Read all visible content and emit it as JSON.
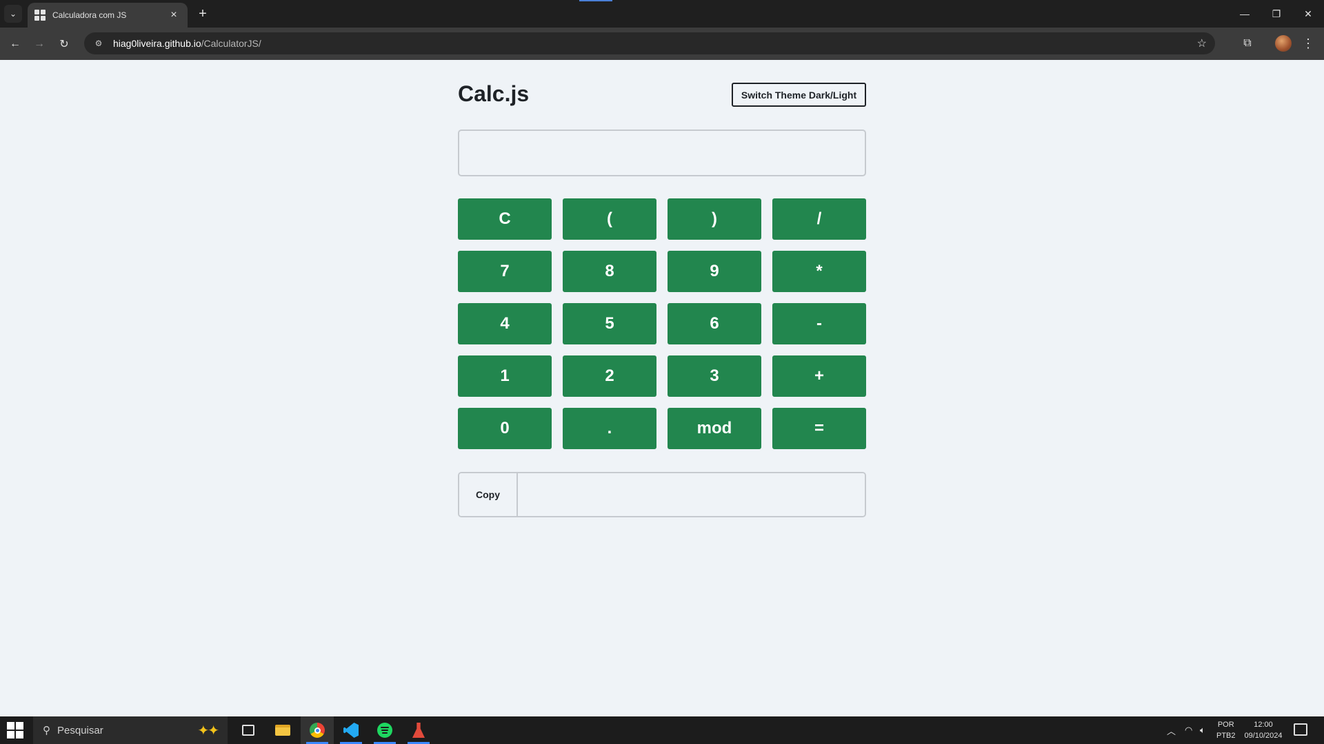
{
  "browser": {
    "tab_title": "Calculadora com JS",
    "tab_close": "×",
    "new_tab": "+",
    "tab_list": "⌄",
    "url_host": "hiag0liveira.github.io",
    "url_path": "/CalculatorJS/",
    "back": "←",
    "forward": "→",
    "reload": "↻",
    "star": "☆",
    "extensions": "⧉",
    "menu": "⋮",
    "window_controls": {
      "minimize": "—",
      "restore": "❐",
      "close": "✕"
    }
  },
  "app": {
    "title": "Calc.js",
    "theme_button": "Switch Theme Dark/Light",
    "display_value": "",
    "keys": [
      "C",
      "(",
      ")",
      "/",
      "7",
      "8",
      "9",
      "*",
      "4",
      "5",
      "6",
      "-",
      "1",
      "2",
      "3",
      "+",
      "0",
      ".",
      "mod",
      "="
    ],
    "copy_label": "Copy",
    "result_value": ""
  },
  "colors": {
    "page_background": "#eff3f7",
    "key_green": "#22864e",
    "text_dark": "#1e2227"
  },
  "taskbar": {
    "search_placeholder": "Pesquisar",
    "apps": [
      "task-view",
      "file-explorer",
      "chrome",
      "vscode",
      "spotify",
      "git-tool"
    ],
    "language_line1": "POR",
    "language_line2": "PTB2",
    "time": "12:00",
    "date": "09/10/2024"
  }
}
